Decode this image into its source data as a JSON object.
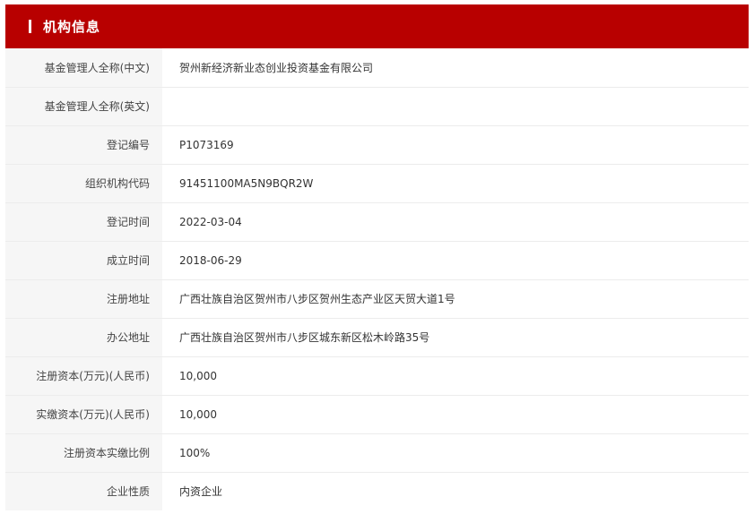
{
  "section": {
    "title": "机构信息",
    "accent_color": "#b80000"
  },
  "rows": [
    {
      "label": "基金管理人全称(中文)",
      "value": "贺州新经济新业态创业投资基金有限公司"
    },
    {
      "label": "基金管理人全称(英文)",
      "value": ""
    },
    {
      "label": "登记编号",
      "value": "P1073169"
    },
    {
      "label": "组织机构代码",
      "value": "91451100MA5N9BQR2W"
    },
    {
      "label": "登记时间",
      "value": "2022-03-04"
    },
    {
      "label": "成立时间",
      "value": "2018-06-29"
    },
    {
      "label": "注册地址",
      "value": "广西壮族自治区贺州市八步区贺州生态产业区天贸大道1号"
    },
    {
      "label": "办公地址",
      "value": "广西壮族自治区贺州市八步区城东新区松木岭路35号"
    },
    {
      "label": "注册资本(万元)(人民币)",
      "value": "10,000"
    },
    {
      "label": "实缴资本(万元)(人民币)",
      "value": "10,000"
    },
    {
      "label": "注册资本实缴比例",
      "value": "100%"
    },
    {
      "label": "企业性质",
      "value": "内资企业"
    }
  ]
}
